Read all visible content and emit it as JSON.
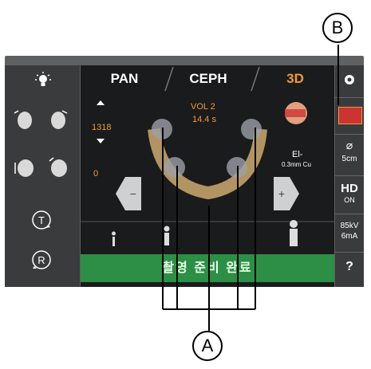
{
  "tabs": [
    {
      "label": "PAN",
      "active": false
    },
    {
      "label": "CEPH",
      "active": false
    },
    {
      "label": "3D",
      "active": true
    }
  ],
  "volume": {
    "name": "VOL 2",
    "time": "14.4 s"
  },
  "position_value": "1318",
  "zero_value": "0",
  "filter": {
    "label": "El-",
    "sub": "0.3mm Cu"
  },
  "right_sidebar": {
    "ffov": "5cm",
    "hd": "HD",
    "hd_state": "ON",
    "kv": "85kV",
    "ma": "6mA",
    "help": "?"
  },
  "status_message": "촬영 준비 완료",
  "callouts": {
    "a": "A",
    "b": "B"
  },
  "colors": {
    "accent": "#f39a33",
    "ready": "#2d8f45",
    "panel": "#3a3b3d"
  }
}
